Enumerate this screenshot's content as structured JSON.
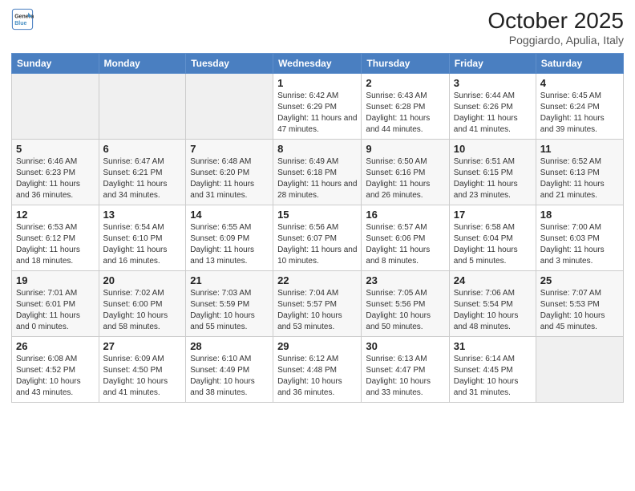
{
  "logo": {
    "line1": "General",
    "line2": "Blue"
  },
  "title": "October 2025",
  "subtitle": "Poggiardo, Apulia, Italy",
  "weekdays": [
    "Sunday",
    "Monday",
    "Tuesday",
    "Wednesday",
    "Thursday",
    "Friday",
    "Saturday"
  ],
  "weeks": [
    [
      {
        "day": "",
        "info": ""
      },
      {
        "day": "",
        "info": ""
      },
      {
        "day": "",
        "info": ""
      },
      {
        "day": "1",
        "info": "Sunrise: 6:42 AM\nSunset: 6:29 PM\nDaylight: 11 hours and 47 minutes."
      },
      {
        "day": "2",
        "info": "Sunrise: 6:43 AM\nSunset: 6:28 PM\nDaylight: 11 hours and 44 minutes."
      },
      {
        "day": "3",
        "info": "Sunrise: 6:44 AM\nSunset: 6:26 PM\nDaylight: 11 hours and 41 minutes."
      },
      {
        "day": "4",
        "info": "Sunrise: 6:45 AM\nSunset: 6:24 PM\nDaylight: 11 hours and 39 minutes."
      }
    ],
    [
      {
        "day": "5",
        "info": "Sunrise: 6:46 AM\nSunset: 6:23 PM\nDaylight: 11 hours and 36 minutes."
      },
      {
        "day": "6",
        "info": "Sunrise: 6:47 AM\nSunset: 6:21 PM\nDaylight: 11 hours and 34 minutes."
      },
      {
        "day": "7",
        "info": "Sunrise: 6:48 AM\nSunset: 6:20 PM\nDaylight: 11 hours and 31 minutes."
      },
      {
        "day": "8",
        "info": "Sunrise: 6:49 AM\nSunset: 6:18 PM\nDaylight: 11 hours and 28 minutes."
      },
      {
        "day": "9",
        "info": "Sunrise: 6:50 AM\nSunset: 6:16 PM\nDaylight: 11 hours and 26 minutes."
      },
      {
        "day": "10",
        "info": "Sunrise: 6:51 AM\nSunset: 6:15 PM\nDaylight: 11 hours and 23 minutes."
      },
      {
        "day": "11",
        "info": "Sunrise: 6:52 AM\nSunset: 6:13 PM\nDaylight: 11 hours and 21 minutes."
      }
    ],
    [
      {
        "day": "12",
        "info": "Sunrise: 6:53 AM\nSunset: 6:12 PM\nDaylight: 11 hours and 18 minutes."
      },
      {
        "day": "13",
        "info": "Sunrise: 6:54 AM\nSunset: 6:10 PM\nDaylight: 11 hours and 16 minutes."
      },
      {
        "day": "14",
        "info": "Sunrise: 6:55 AM\nSunset: 6:09 PM\nDaylight: 11 hours and 13 minutes."
      },
      {
        "day": "15",
        "info": "Sunrise: 6:56 AM\nSunset: 6:07 PM\nDaylight: 11 hours and 10 minutes."
      },
      {
        "day": "16",
        "info": "Sunrise: 6:57 AM\nSunset: 6:06 PM\nDaylight: 11 hours and 8 minutes."
      },
      {
        "day": "17",
        "info": "Sunrise: 6:58 AM\nSunset: 6:04 PM\nDaylight: 11 hours and 5 minutes."
      },
      {
        "day": "18",
        "info": "Sunrise: 7:00 AM\nSunset: 6:03 PM\nDaylight: 11 hours and 3 minutes."
      }
    ],
    [
      {
        "day": "19",
        "info": "Sunrise: 7:01 AM\nSunset: 6:01 PM\nDaylight: 11 hours and 0 minutes."
      },
      {
        "day": "20",
        "info": "Sunrise: 7:02 AM\nSunset: 6:00 PM\nDaylight: 10 hours and 58 minutes."
      },
      {
        "day": "21",
        "info": "Sunrise: 7:03 AM\nSunset: 5:59 PM\nDaylight: 10 hours and 55 minutes."
      },
      {
        "day": "22",
        "info": "Sunrise: 7:04 AM\nSunset: 5:57 PM\nDaylight: 10 hours and 53 minutes."
      },
      {
        "day": "23",
        "info": "Sunrise: 7:05 AM\nSunset: 5:56 PM\nDaylight: 10 hours and 50 minutes."
      },
      {
        "day": "24",
        "info": "Sunrise: 7:06 AM\nSunset: 5:54 PM\nDaylight: 10 hours and 48 minutes."
      },
      {
        "day": "25",
        "info": "Sunrise: 7:07 AM\nSunset: 5:53 PM\nDaylight: 10 hours and 45 minutes."
      }
    ],
    [
      {
        "day": "26",
        "info": "Sunrise: 6:08 AM\nSunset: 4:52 PM\nDaylight: 10 hours and 43 minutes."
      },
      {
        "day": "27",
        "info": "Sunrise: 6:09 AM\nSunset: 4:50 PM\nDaylight: 10 hours and 41 minutes."
      },
      {
        "day": "28",
        "info": "Sunrise: 6:10 AM\nSunset: 4:49 PM\nDaylight: 10 hours and 38 minutes."
      },
      {
        "day": "29",
        "info": "Sunrise: 6:12 AM\nSunset: 4:48 PM\nDaylight: 10 hours and 36 minutes."
      },
      {
        "day": "30",
        "info": "Sunrise: 6:13 AM\nSunset: 4:47 PM\nDaylight: 10 hours and 33 minutes."
      },
      {
        "day": "31",
        "info": "Sunrise: 6:14 AM\nSunset: 4:45 PM\nDaylight: 10 hours and 31 minutes."
      },
      {
        "day": "",
        "info": ""
      }
    ]
  ]
}
